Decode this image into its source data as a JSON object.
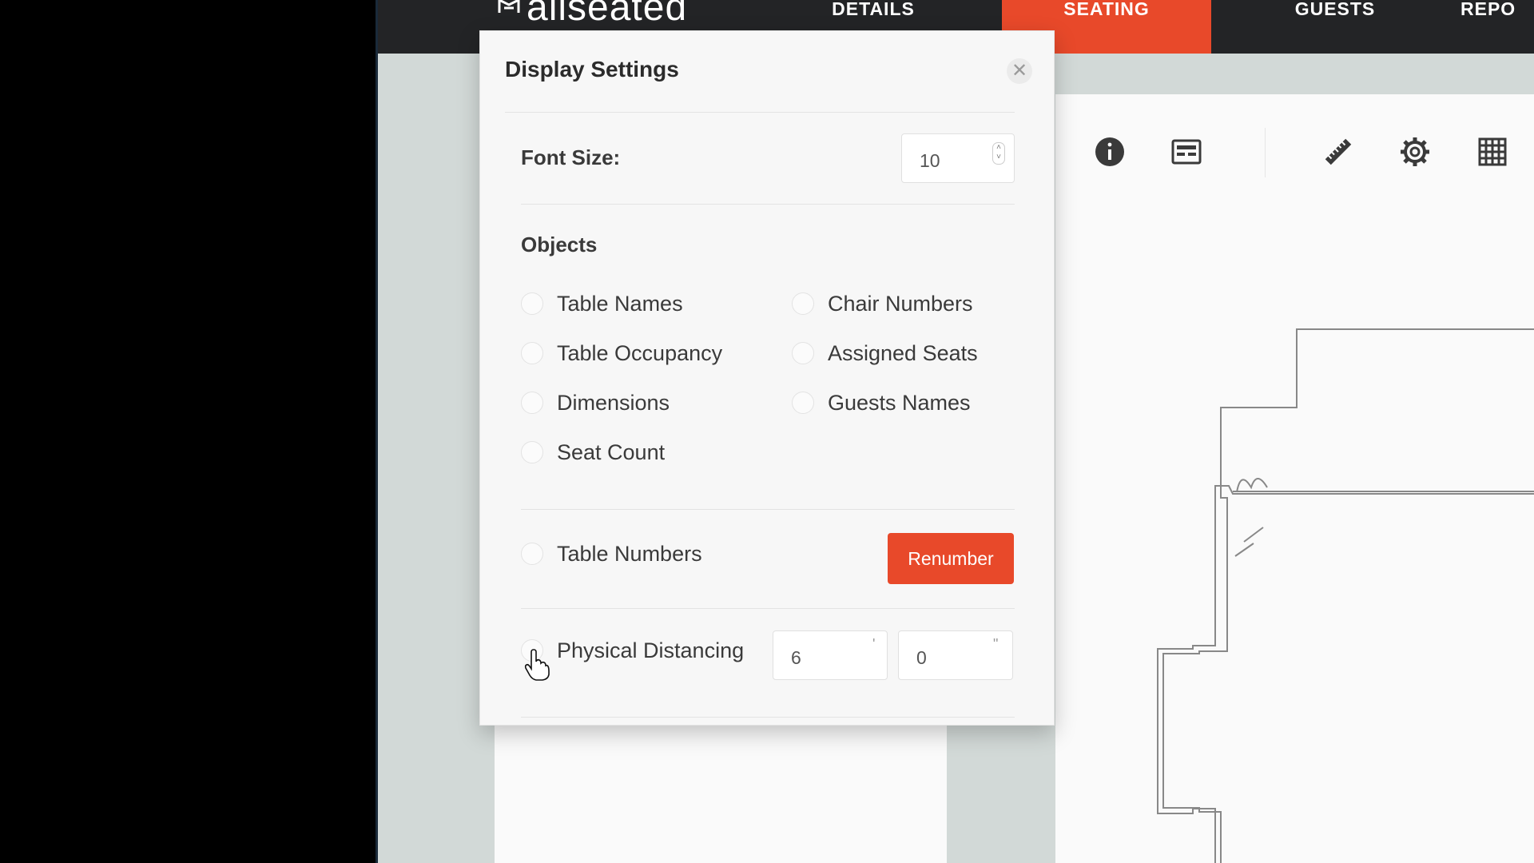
{
  "app": {
    "logo_text": "allseated",
    "nav": [
      "DETAILS",
      "SEATING",
      "GUESTS",
      "REPO"
    ],
    "active_nav": "SEATING",
    "accent_color": "#e8492a"
  },
  "toolbar": {
    "icons": [
      "info-icon",
      "layout-icon",
      "ruler-icon",
      "gear-icon",
      "grid-icon"
    ]
  },
  "display_settings": {
    "title": "Display Settings",
    "close_glyph": "✕",
    "font_size": {
      "label": "Font Size:",
      "value": "10"
    },
    "objects": {
      "title": "Objects",
      "options": [
        {
          "label": "Table Names",
          "checked": false
        },
        {
          "label": "Chair Numbers",
          "checked": false
        },
        {
          "label": "Table Occupancy",
          "checked": false
        },
        {
          "label": "Assigned Seats",
          "checked": false
        },
        {
          "label": "Dimensions",
          "checked": false
        },
        {
          "label": "Guests Names",
          "checked": false
        },
        {
          "label": "Seat Count",
          "checked": false
        }
      ]
    },
    "table_numbers": {
      "label": "Table Numbers",
      "checked": false,
      "button_label": "Renumber"
    },
    "physical_distancing": {
      "label": "Physical Distancing",
      "checked": false,
      "feet": "6",
      "feet_unit": "'",
      "inches": "0",
      "inches_unit": "\""
    }
  }
}
